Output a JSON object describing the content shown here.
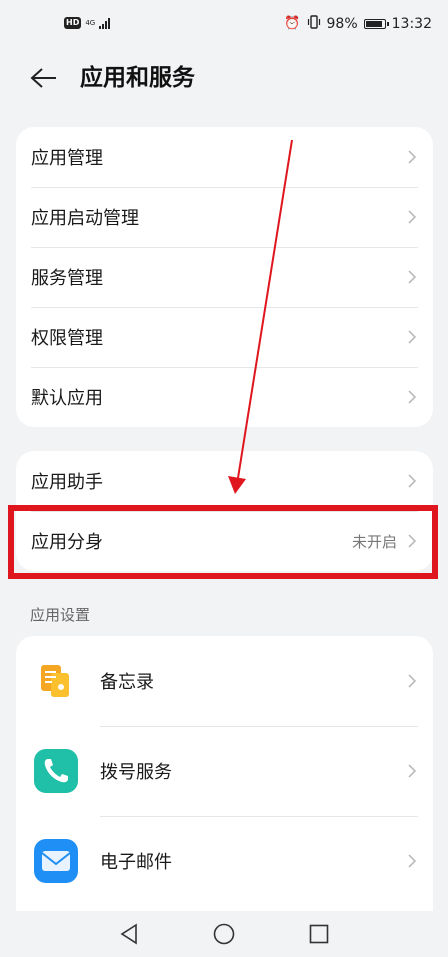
{
  "status_bar": {
    "hd": "HD",
    "network": "4G",
    "battery_percent": "98%",
    "battery_level": 0.98,
    "time": "13:32"
  },
  "header": {
    "back_icon": "arrow-left-icon",
    "title": "应用和服务"
  },
  "group1": {
    "items": [
      {
        "label": "应用管理"
      },
      {
        "label": "应用启动管理"
      },
      {
        "label": "服务管理"
      },
      {
        "label": "权限管理"
      },
      {
        "label": "默认应用"
      }
    ]
  },
  "group2": {
    "items": [
      {
        "label": "应用助手"
      },
      {
        "label": "应用分身",
        "value": "未开启"
      }
    ]
  },
  "app_settings": {
    "section_title": "应用设置",
    "items": [
      {
        "label": "备忘录",
        "icon": "notepad-icon",
        "color": "#f5a623"
      },
      {
        "label": "拨号服务",
        "icon": "phone-icon",
        "color": "#1fbfa8"
      },
      {
        "label": "电子邮件",
        "icon": "mail-icon",
        "color": "#1f8ef5"
      }
    ]
  },
  "annotation": {
    "color": "#e0161e"
  },
  "nav_bar": {
    "back": "nav-back-icon",
    "home": "nav-home-icon",
    "recents": "nav-recents-icon"
  }
}
